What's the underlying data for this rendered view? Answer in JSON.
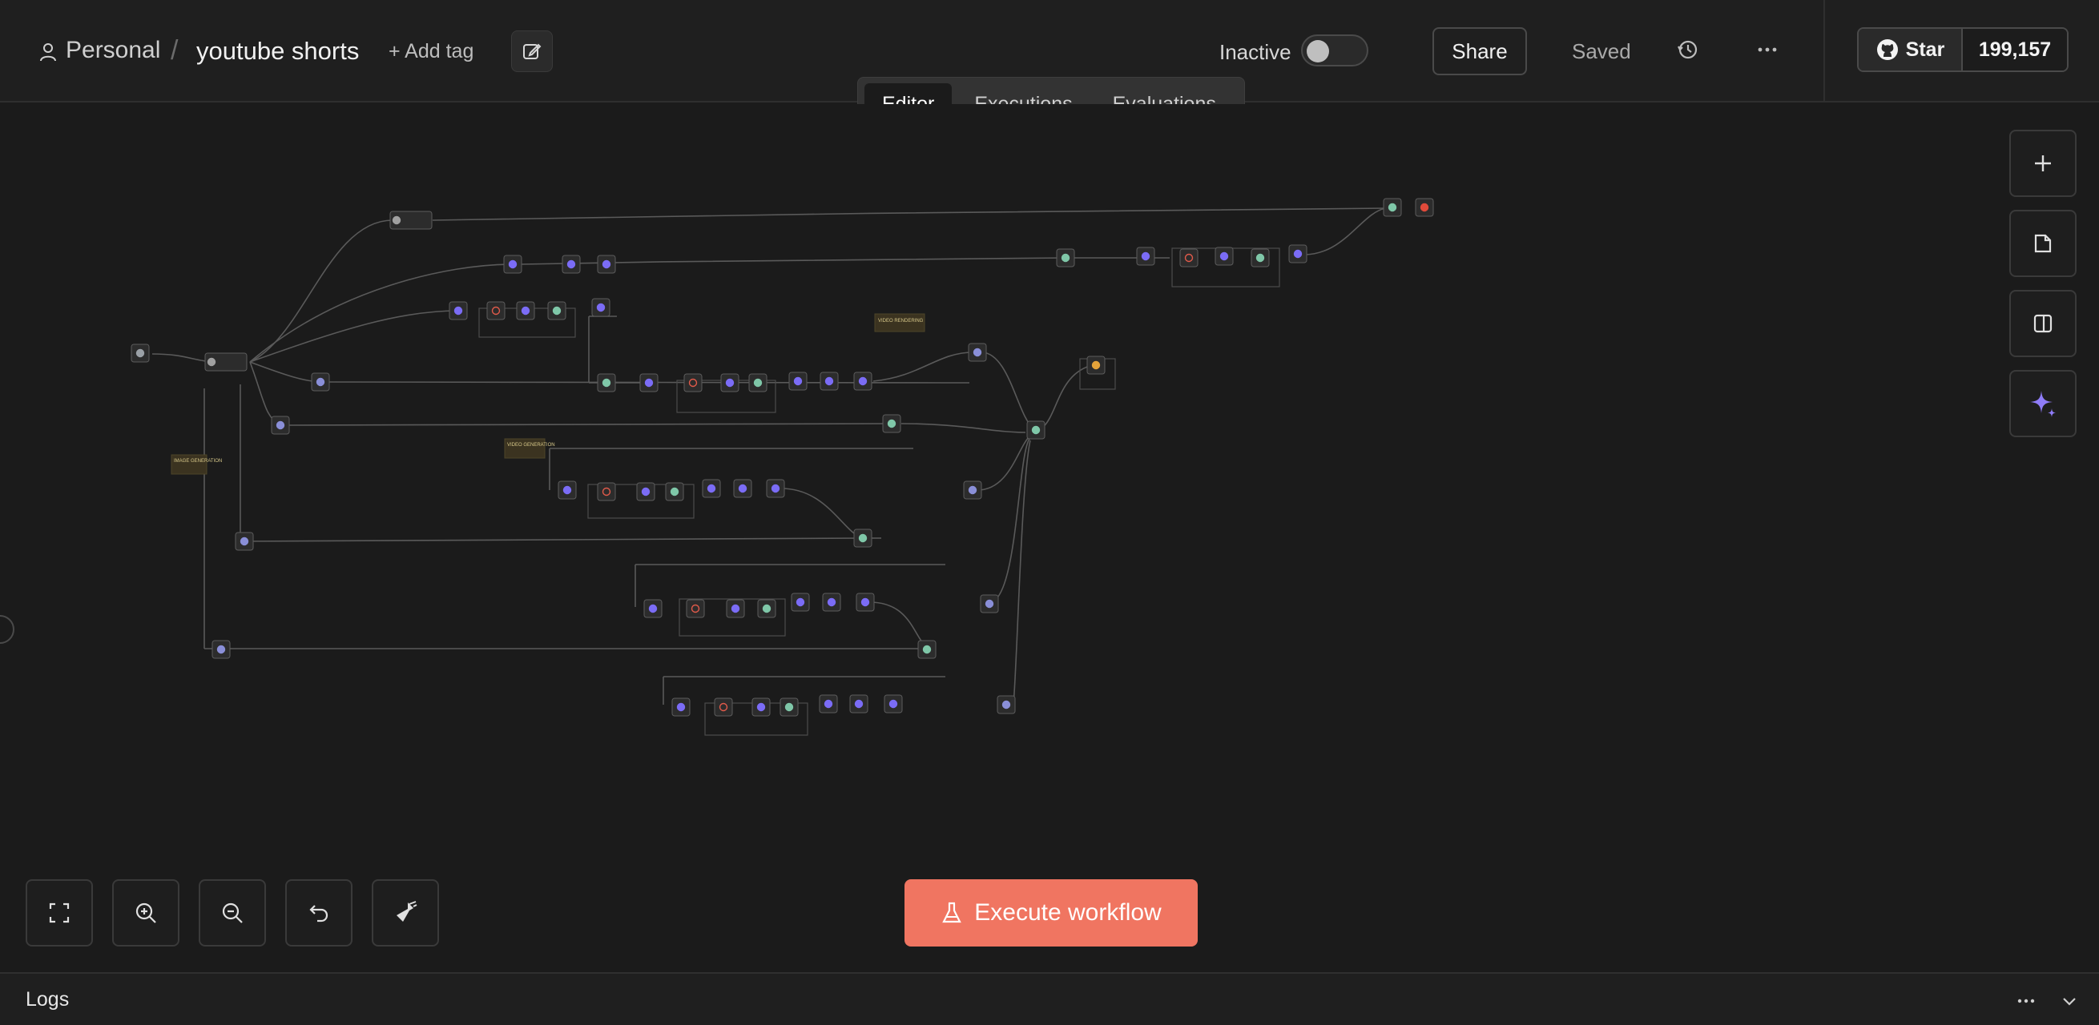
{
  "header": {
    "project": "Personal",
    "separator": "/",
    "workflow_name": "youtube shorts",
    "add_tag": "+ Add tag",
    "status_label": "Inactive",
    "share_label": "Share",
    "saved_label": "Saved",
    "github": {
      "star_label": "Star",
      "count": "199,157"
    }
  },
  "tabs": [
    {
      "label": "Editor",
      "active": true
    },
    {
      "label": "Executions",
      "active": false
    },
    {
      "label": "Evaluations",
      "active": false
    }
  ],
  "canvas": {
    "sticky_notes": [
      "VIDEO RENDERING",
      "VIDEO GENERATION",
      "IMAGE GENERATION"
    ],
    "node_color": "#3a3a44",
    "accent_purple": "#7b6cf6",
    "accent_red": "#e05a4a"
  },
  "bottom": {
    "execute_label": "Execute workflow",
    "execute_color": "#f07561"
  },
  "logs": {
    "label": "Logs"
  },
  "icons": {
    "right_tools": [
      "plus-icon",
      "sticky-note-icon",
      "panel-icon",
      "ai-sparkle-icon"
    ],
    "bottom_tools": [
      "fit-view-icon",
      "zoom-in-icon",
      "zoom-out-icon",
      "undo-icon",
      "tidy-up-icon"
    ]
  }
}
